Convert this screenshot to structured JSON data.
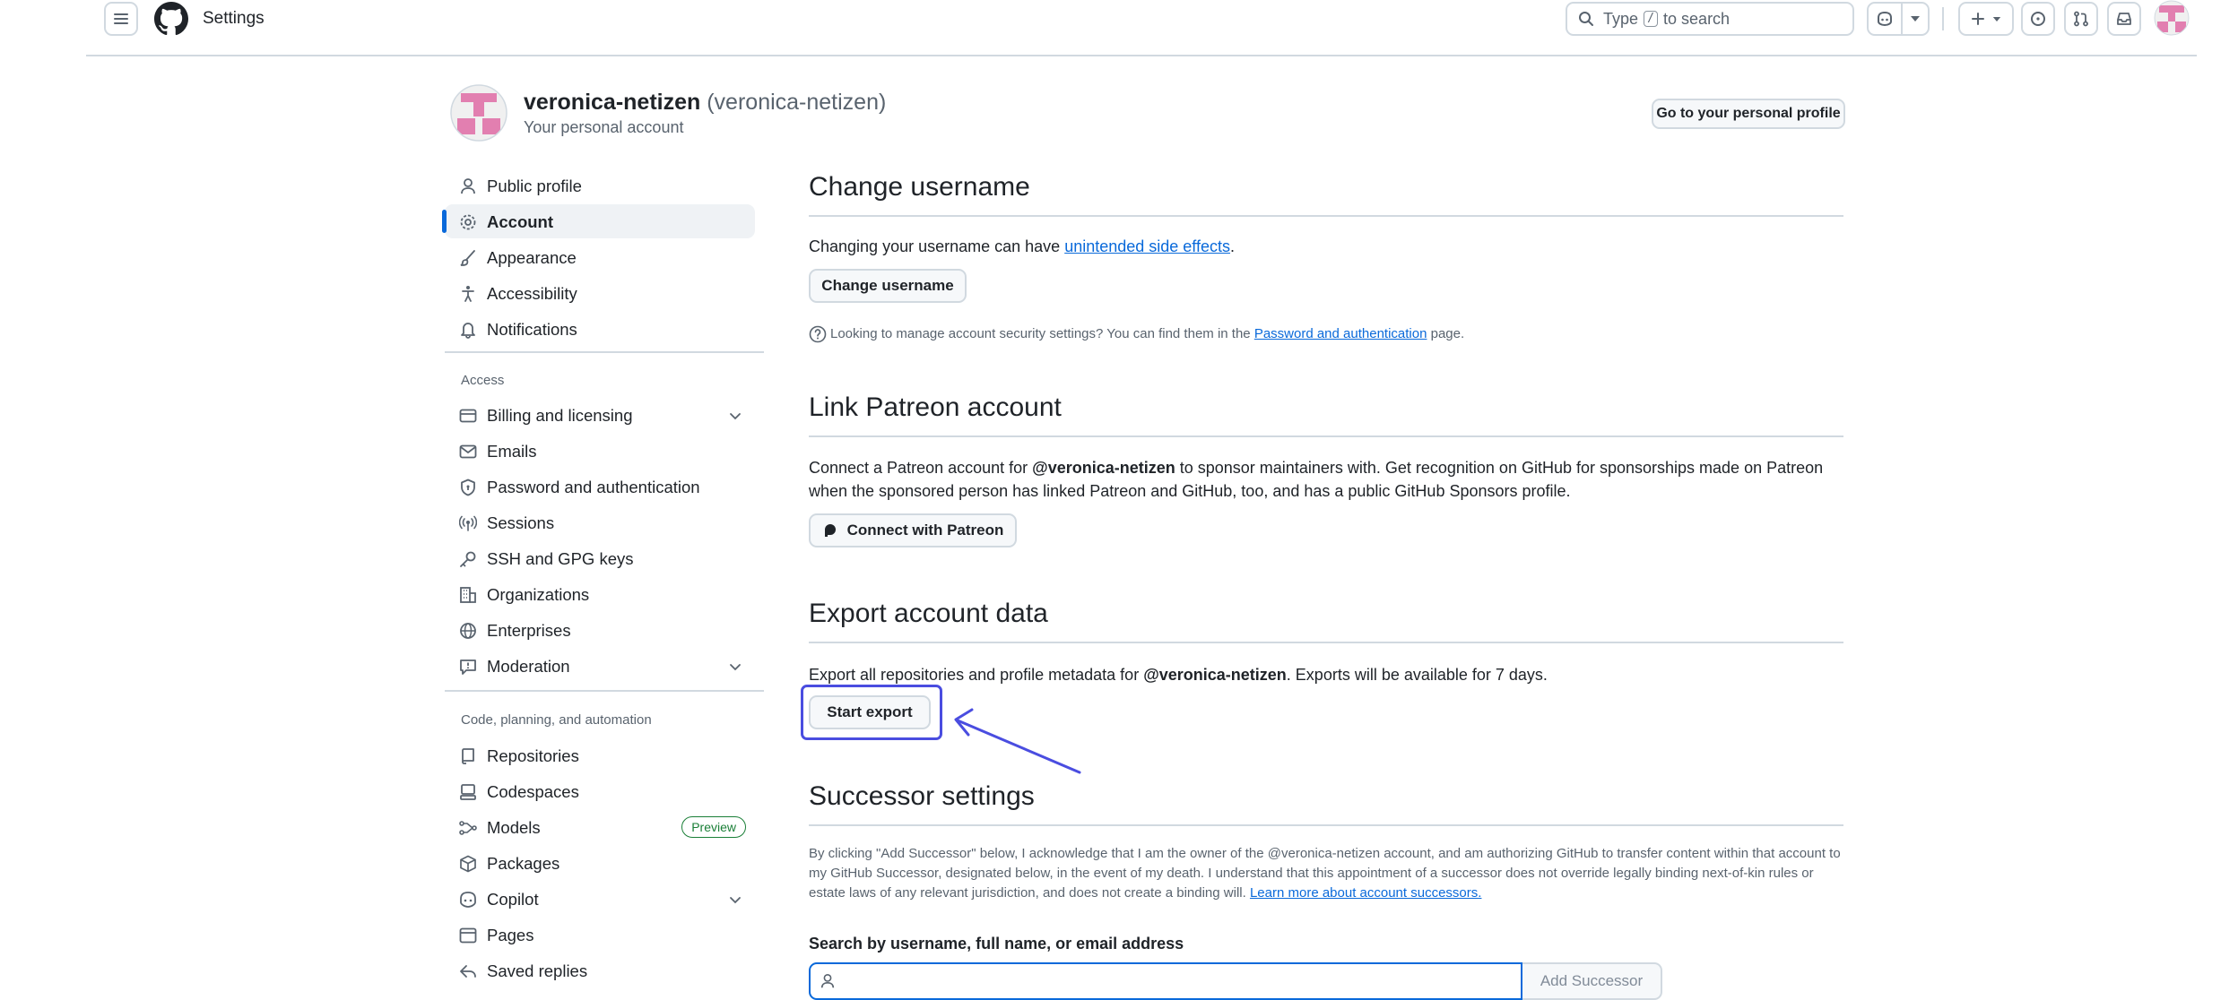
{
  "header": {
    "title": "Settings",
    "search_prefix": "Type",
    "search_key": "/",
    "search_suffix": "to search"
  },
  "profile": {
    "name": "veronica-netizen",
    "login": "(veronica-netizen)",
    "subtitle": "Your personal account",
    "go_button": "Go to your personal profile"
  },
  "sidebar": {
    "items": [
      {
        "label": "Public profile",
        "icon": "person-icon"
      },
      {
        "label": "Account",
        "icon": "gear-icon",
        "active": true
      },
      {
        "label": "Appearance",
        "icon": "paintbrush-icon"
      },
      {
        "label": "Accessibility",
        "icon": "accessibility-icon"
      },
      {
        "label": "Notifications",
        "icon": "bell-icon"
      }
    ],
    "access_heading": "Access",
    "access_items": [
      {
        "label": "Billing and licensing",
        "icon": "credit-card-icon"
      },
      {
        "label": "Emails",
        "icon": "mail-icon"
      },
      {
        "label": "Password and authentication",
        "icon": "shield-lock-icon"
      },
      {
        "label": "Sessions",
        "icon": "broadcast-icon"
      },
      {
        "label": "SSH and GPG keys",
        "icon": "key-icon"
      },
      {
        "label": "Organizations",
        "icon": "organization-icon"
      },
      {
        "label": "Enterprises",
        "icon": "globe-icon"
      },
      {
        "label": "Moderation",
        "icon": "report-icon"
      }
    ],
    "code_heading": "Code, planning, and automation",
    "code_items": [
      {
        "label": "Repositories",
        "icon": "repo-icon"
      },
      {
        "label": "Codespaces",
        "icon": "codespaces-icon"
      },
      {
        "label": "Models",
        "icon": "models-icon",
        "badge": "Preview"
      },
      {
        "label": "Packages",
        "icon": "package-icon"
      },
      {
        "label": "Copilot",
        "icon": "copilot-icon"
      },
      {
        "label": "Pages",
        "icon": "browser-icon"
      },
      {
        "label": "Saved replies",
        "icon": "reply-icon"
      }
    ]
  },
  "sections": {
    "username": {
      "title": "Change username",
      "text_before": "Changing your username can have ",
      "link": "unintended side effects",
      "text_after": ".",
      "button": "Change username",
      "note_before": "Looking to manage account security settings? You can find them in the ",
      "note_link": "Password and authentication",
      "note_after": " page."
    },
    "patreon": {
      "title": "Link Patreon account",
      "text_before": "Connect a Patreon account for ",
      "handle": "@veronica-netizen",
      "text_after": " to sponsor maintainers with. Get recognition on GitHub for sponsorships made on Patreon when the sponsored person has linked Patreon and GitHub, too, and has a public GitHub Sponsors profile.",
      "button": "Connect with Patreon"
    },
    "export": {
      "title": "Export account data",
      "text_before": "Export all repositories and profile metadata for ",
      "handle": "@veronica-netizen",
      "text_after": ". Exports will be available for 7 days.",
      "button": "Start export"
    },
    "successor": {
      "title": "Successor settings",
      "text": "By clicking \"Add Successor\" below, I acknowledge that I am the owner of the @veronica-netizen account, and am authorizing GitHub to transfer content within that account to my GitHub Successor, designated below, in the event of my death. I understand that this appointment of a successor does not override legally binding next-of-kin rules or estate laws of any relevant jurisdiction, and does not create a binding will. ",
      "link": "Learn more about account successors.",
      "search_label": "Search by username, full name, or email address",
      "input_value": "",
      "button": "Add Successor"
    }
  },
  "colors": {
    "accent": "#0969da",
    "annotation": "#4a4de0",
    "avatar_pink": "#e27fb0"
  }
}
